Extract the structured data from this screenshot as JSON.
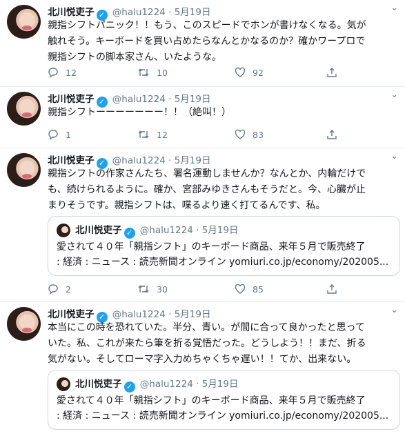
{
  "author": {
    "name": "北川悦吏子",
    "handle": "@halu1224"
  },
  "tweets": [
    {
      "date": "5月19日",
      "text": "親指シフトパニック！！もう、このスピードでホンが書けなくなる。気が\n触れそう。キーボードを買い占めたらなんとかなるのか？確かワープロで\n親指シフトの脚本家さん、いたような。",
      "replies": "12",
      "retweets": "10",
      "likes": "92"
    },
    {
      "date": "5月19日",
      "text": "親指シフトーーーーーーー！！（絶叫！）",
      "replies": "1",
      "retweets": "12",
      "likes": "83"
    },
    {
      "date": "5月19日",
      "text": "親指シフトの作家さんたち、署名運動しませんか？なんとか、内輪だけで\nも、続けられるように。確か、宮部みゆきさんもそうだと。今、心臓が止\nまりそうです。親指シフトは、喋るより速く打てるんです、私。",
      "quote": {
        "name": "北川悦吏子",
        "handle": "@halu1224",
        "date": "5月19日",
        "text": "愛されて４０年「親指シフト」のキーボード商品、来年５月で販売終了\n: 経済 : ニュース : 読売新聞オンライン yomiuri.co.jp/economy/202005..."
      },
      "replies": "2",
      "retweets": "30",
      "likes": "85"
    },
    {
      "date": "5月19日",
      "text": "本当にこの時を恐れていた。半分、青い。が間に合って良かったと思って\nいた。私、これが来たら筆を折る覚悟だった。どうしよう！！まだ、折る\n気がない。そしてローマ字入力めちゃくちゃ遅い！！てか、出来ない。",
      "quote": {
        "name": "北川悦吏子",
        "handle": "@halu1224",
        "date": "5月19日",
        "text": "愛されて４０年「親指シフト」のキーボード商品、来年５月で販売終了\n: 経済 : ニュース : 読売新聞オンライン yomiuri.co.jp/economy/202005..."
      }
    }
  ],
  "icons": {
    "verified": "verified-badge-icon",
    "reply": "reply-icon",
    "retweet": "retweet-icon",
    "like": "heart-icon",
    "share": "share-icon",
    "caret": "chevron-down-icon"
  },
  "colors": {
    "verified": "#1da1f2",
    "meta": "#657786",
    "border": "#e6ecf0"
  }
}
